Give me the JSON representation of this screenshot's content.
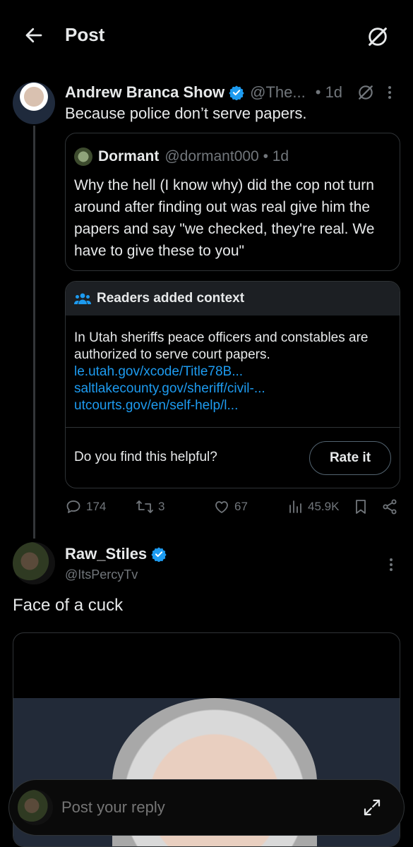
{
  "header": {
    "title": "Post",
    "back_icon": "arrow-left-icon",
    "grok_icon": "grok-icon"
  },
  "post": {
    "author": "Andrew Branca Show",
    "handle": "@The...",
    "time": "• 1d",
    "text": "Because police don’t serve papers.",
    "quote": {
      "author": "Dormant",
      "handle": "@dormant000 • 1d",
      "text": "Why the hell (I know why) did the cop not turn around after finding out was real give him the papers and say \"we checked, they're real. We have to give these to you\""
    },
    "community_note": {
      "title": "Readers added context",
      "body": "In Utah sheriffs peace officers and constables are authorized to serve court papers.",
      "links": [
        "le.utah.gov/xcode/Title78B...",
        "saltlakecounty.gov/sheriff/civil-...",
        "utcourts.gov/en/self-help/l..."
      ],
      "question": "Do you find this helpful?",
      "rate_label": "Rate it"
    },
    "stats": {
      "replies": "174",
      "reposts": "3",
      "likes": "67",
      "views": "45.9K"
    }
  },
  "reply": {
    "author": "Raw_Stiles",
    "handle": "@ItsPercyTv",
    "text": "Face of a cuck"
  },
  "composer": {
    "placeholder": "Post your reply"
  },
  "colors": {
    "accent": "#1d9bf0",
    "bg": "#000000",
    "muted": "#71767b",
    "border": "#2f3336"
  }
}
